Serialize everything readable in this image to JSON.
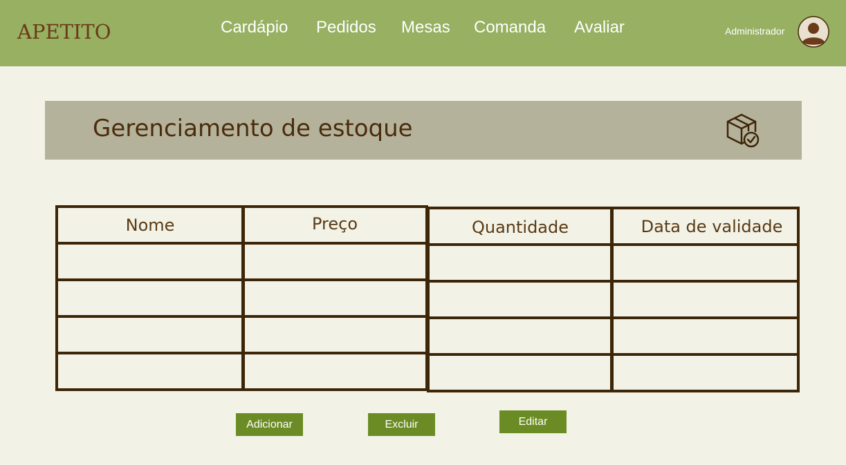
{
  "header": {
    "brand": "APETITO",
    "nav": [
      {
        "label": "Cardápio"
      },
      {
        "label": "Pedidos"
      },
      {
        "label": "Mesas"
      },
      {
        "label": "Comanda"
      },
      {
        "label": "Avaliar"
      }
    ],
    "user_label": "Administrador",
    "avatar_icon": "user-avatar-icon"
  },
  "page": {
    "title": "Gerenciamento de estoque",
    "title_icon": "box-check-icon"
  },
  "table": {
    "columns": [
      "Nome",
      "Preço",
      "Quantidade",
      "Data de validade"
    ],
    "rows": [
      [
        "",
        "",
        "",
        ""
      ],
      [
        "",
        "",
        "",
        ""
      ],
      [
        "",
        "",
        "",
        ""
      ],
      [
        "",
        "",
        "",
        ""
      ]
    ]
  },
  "actions": {
    "add_label": "Adicionar",
    "delete_label": "Excluir",
    "edit_label": "Editar"
  },
  "colors": {
    "header_bg": "#97b062",
    "page_bg": "#f2f2e7",
    "title_band_bg": "#b5b29b",
    "border": "#3d2508",
    "button_bg": "#6b8c24",
    "brand": "#6b3a18"
  }
}
